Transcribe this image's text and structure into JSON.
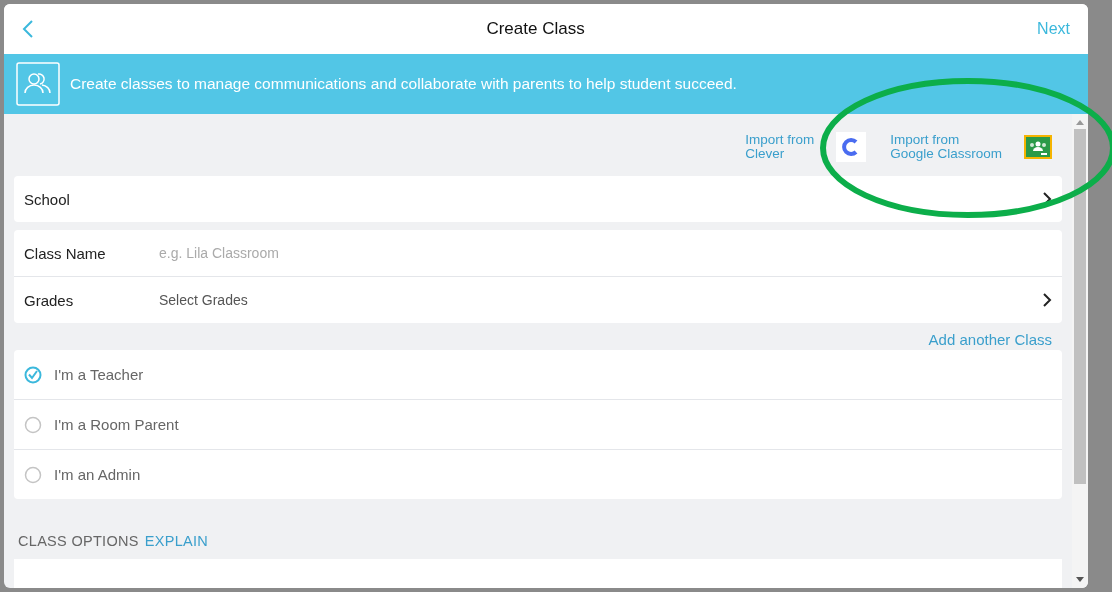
{
  "header": {
    "title": "Create Class",
    "next": "Next"
  },
  "banner": {
    "text": "Create classes to manage communications and collaborate with parents to help student succeed."
  },
  "imports": [
    {
      "kind": "clever",
      "lines": [
        "Import from",
        "Clever"
      ]
    },
    {
      "kind": "google",
      "lines": [
        "Import from",
        "Google Classroom"
      ]
    }
  ],
  "school": {
    "label": "School"
  },
  "class_fields": [
    {
      "kind": "input",
      "label": "Class Name",
      "placeholder": "e.g. Lila Classroom"
    },
    {
      "kind": "select",
      "label": "Grades",
      "value": "Select Grades"
    }
  ],
  "add_link": "Add another Class",
  "roles": [
    {
      "label": "I'm a Teacher",
      "selected": true
    },
    {
      "label": "I'm a Room Parent",
      "selected": false
    },
    {
      "label": "I'm an Admin",
      "selected": false
    }
  ],
  "options": {
    "title": "CLASS OPTIONS",
    "link": "EXPLAIN"
  }
}
